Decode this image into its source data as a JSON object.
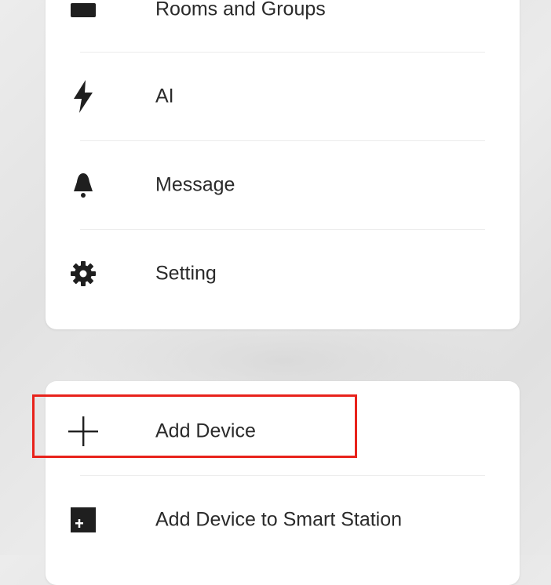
{
  "menu": {
    "items": [
      {
        "label": "Rooms and Groups",
        "icon": "rooms-icon"
      },
      {
        "label": "AI",
        "icon": "lightning-icon"
      },
      {
        "label": "Message",
        "icon": "bell-icon"
      },
      {
        "label": "Setting",
        "icon": "gear-icon"
      }
    ]
  },
  "actions": {
    "items": [
      {
        "label": "Add Device",
        "icon": "plus-icon"
      },
      {
        "label": "Add Device to Smart Station",
        "icon": "add-square-icon"
      }
    ]
  },
  "colors": {
    "highlight": "#e8221b",
    "text": "#2a2a2a",
    "icon": "#1f1f1f"
  }
}
